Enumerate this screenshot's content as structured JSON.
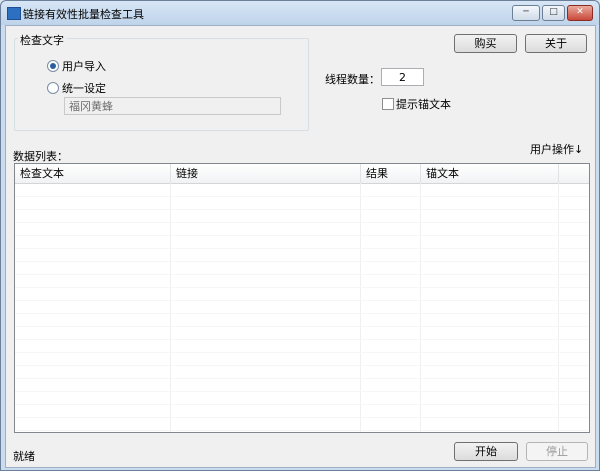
{
  "window": {
    "title": "链接有效性批量检查工具",
    "caption_buttons": {
      "minimize": "─",
      "maximize": "□",
      "close": "✕"
    }
  },
  "check_text_group": {
    "title": "检查文字",
    "options": [
      {
        "label": "用户导入",
        "selected": true
      },
      {
        "label": "统一设定",
        "selected": false
      }
    ],
    "unified_text_value": "福冈黄蜂"
  },
  "toolbar": {
    "buy_label": "购买",
    "about_label": "关于"
  },
  "threads": {
    "label": "线程数量：",
    "value": "2"
  },
  "anchor_text_option": {
    "label": "提示锚文本",
    "checked": false
  },
  "data_list": {
    "label": "数据列表：",
    "user_ops_label": "用户操作↓",
    "columns": [
      "检查文本",
      "链接",
      "结果",
      "锚文本",
      ""
    ],
    "rows": []
  },
  "status_bar": {
    "text": "就绪"
  },
  "actions": {
    "start_label": "开始",
    "stop_label": "停止"
  },
  "colors": {
    "title_bar": "#bfd3ea",
    "client_bg": "#f0f0f0",
    "close_button": "#c9473a",
    "radio_dot": "#2a5f9e"
  }
}
